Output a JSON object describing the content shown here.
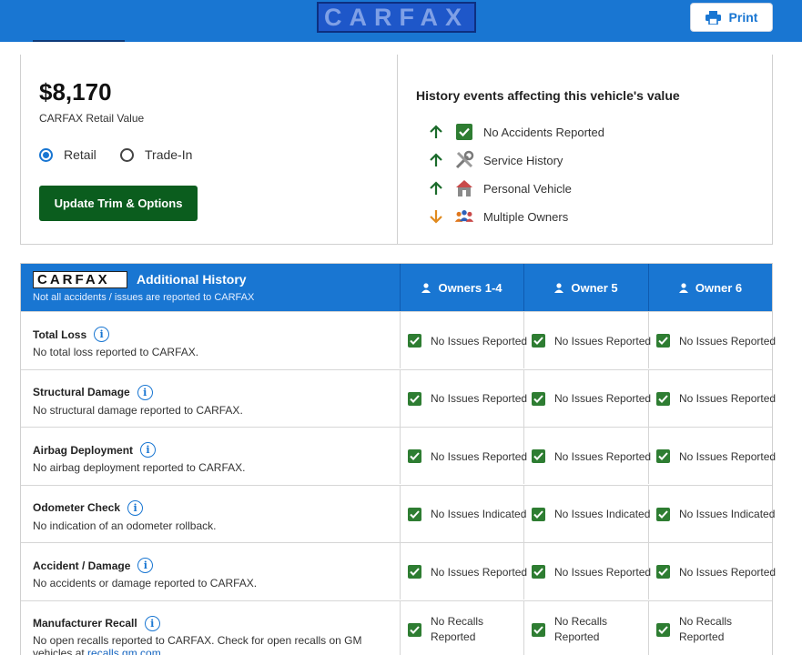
{
  "brand": {
    "logo_text": "CARFAX",
    "color": "#1976d2"
  },
  "header": {
    "print_label": "Print"
  },
  "value": {
    "price": "$8,170",
    "price_label": "CARFAX Retail Value",
    "options": [
      "Retail",
      "Trade-In"
    ],
    "selected_option": "Retail",
    "update_button": "Update Trim & Options"
  },
  "history": {
    "title": "History events affecting this vehicle's value",
    "items": [
      {
        "label": "No Accidents Reported",
        "direction": "up",
        "icon": "green-check-icon"
      },
      {
        "label": "Service History",
        "direction": "up",
        "icon": "tools-icon"
      },
      {
        "label": "Personal Vehicle",
        "direction": "up",
        "icon": "house-icon"
      },
      {
        "label": "Multiple Owners",
        "direction": "down",
        "icon": "people-icon"
      }
    ]
  },
  "additional": {
    "logo_text": "CARFAX",
    "title": "Additional History",
    "subtitle": "Not all accidents / issues are reported to CARFAX",
    "owners": [
      "Owners 1-4",
      "Owner 5",
      "Owner 6"
    ],
    "rows": [
      {
        "title": "Total Loss",
        "desc": "No total loss reported to CARFAX.",
        "status": "No Issues Reported"
      },
      {
        "title": "Structural Damage",
        "desc": "No structural damage reported to CARFAX.",
        "status": "No Issues Reported"
      },
      {
        "title": "Airbag Deployment",
        "desc": "No airbag deployment reported to CARFAX.",
        "status": "No Issues Reported"
      },
      {
        "title": "Odometer Check",
        "desc": "No indication of an odometer rollback.",
        "status": "No Issues Indicated"
      },
      {
        "title": "Accident / Damage",
        "desc": "No accidents or damage reported to CARFAX.",
        "status": "No Issues Reported"
      },
      {
        "title": "Manufacturer Recall",
        "desc": "No open recalls reported to CARFAX. Check for open recalls on GM vehicles at",
        "link": "recalls.gm.com",
        "desc_end": ".",
        "status": "No Recalls Reported"
      }
    ]
  }
}
